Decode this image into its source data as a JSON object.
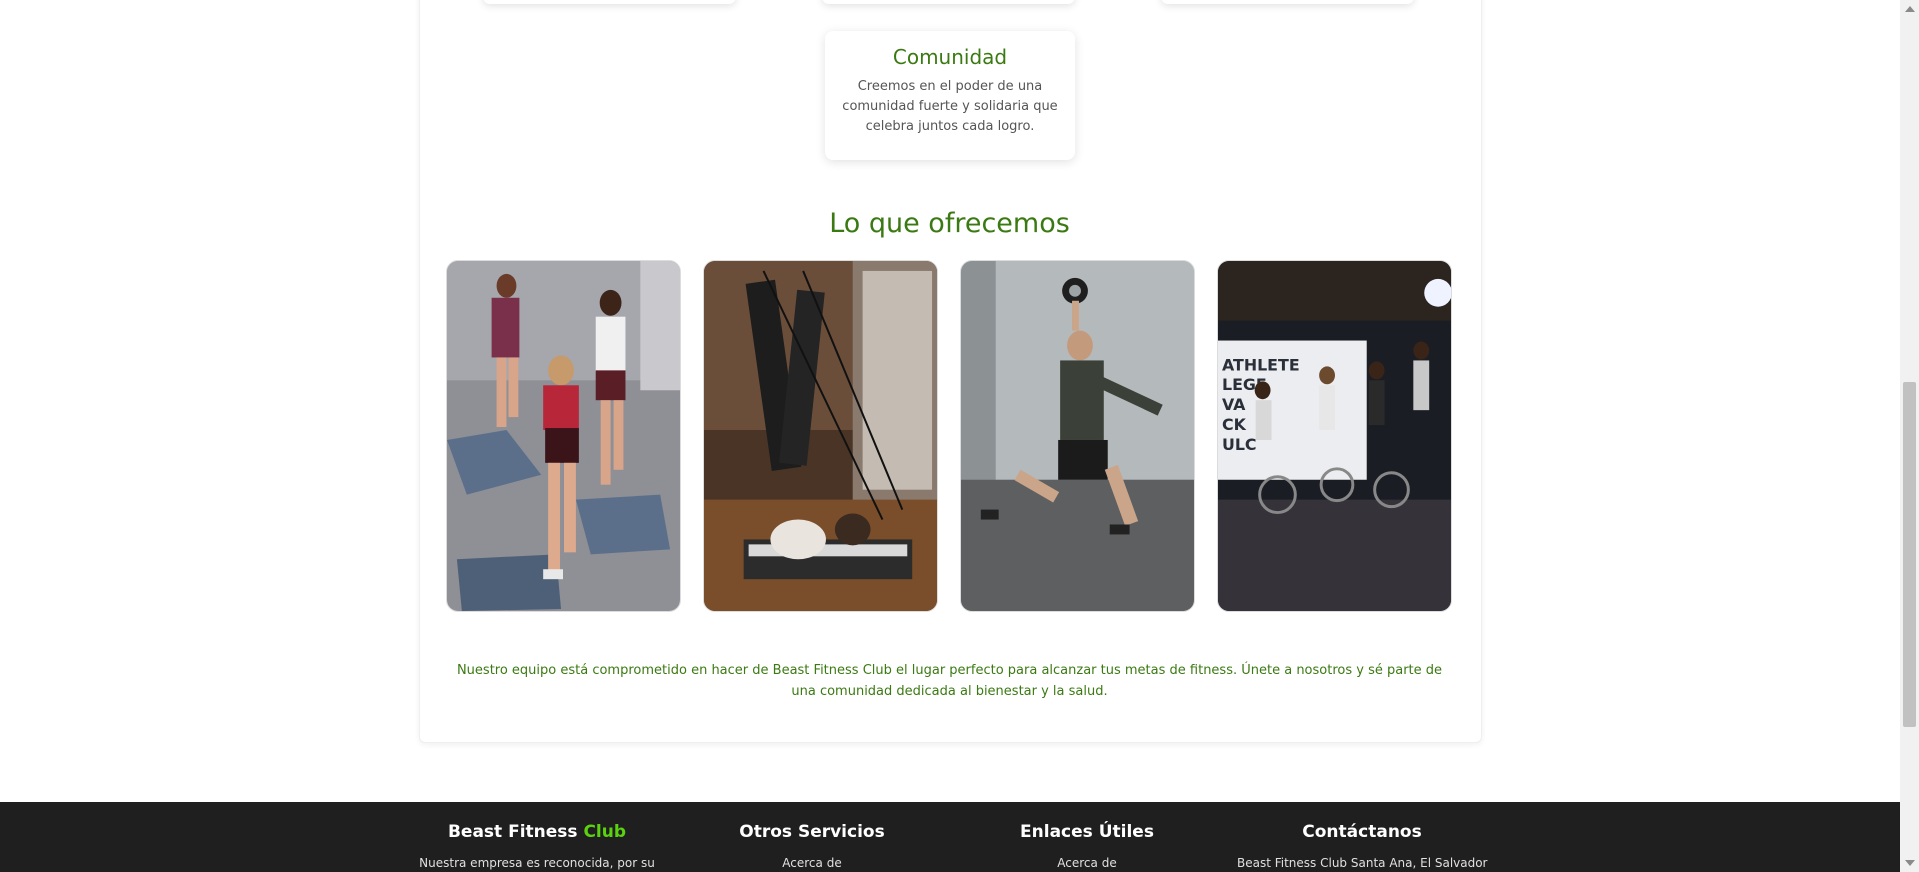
{
  "values_card": {
    "title": "Comunidad",
    "text": "Creemos en el poder de una comunidad fuerte y solidaria que celebra juntos cada logro."
  },
  "offer": {
    "title": "Lo que ofrecemos",
    "intro": "Nuestro equipo está comprometido en hacer de Beast Fitness Club el lugar perfecto para alcanzar tus metas de fitness. Únete a nosotros y sé parte de una comunidad dedicada al bienestar y la salud."
  },
  "footer": {
    "brand": "Beast Fitness",
    "brand_accent": "Club",
    "about_text": "Nuestra empresa es reconocida, por su",
    "services_heading": "Otros Servicios",
    "services_first": "Acerca de",
    "links_heading": "Enlaces Útiles",
    "links_first": "Acerca de",
    "contact_heading": "Contáctanos",
    "contact_first": "Beast Fitness Club Santa Ana, El Salvador"
  },
  "colors": {
    "accent_green": "#3b7a12",
    "footer_bg": "#1f1f1f",
    "footer_accent": "#5bd20f"
  }
}
